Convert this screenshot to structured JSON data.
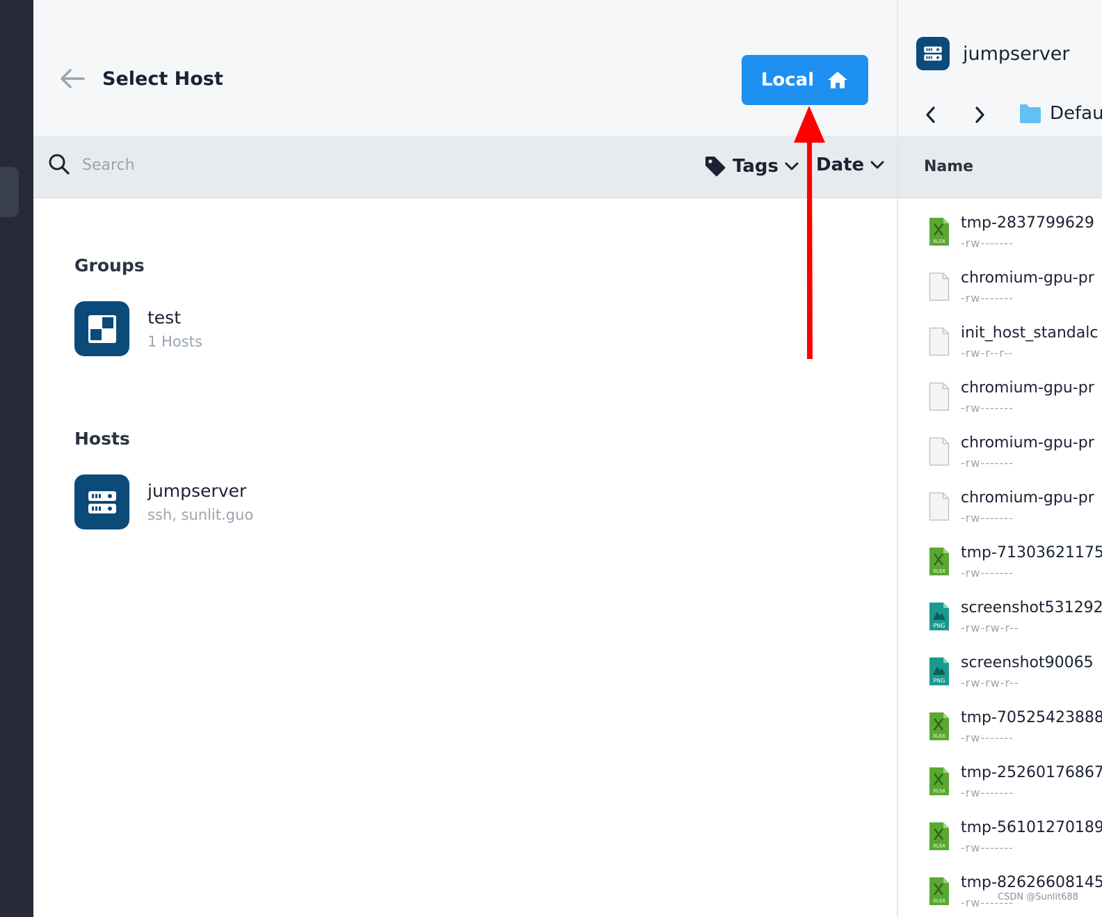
{
  "header": {
    "title": "Select Host",
    "local_button_label": "Local",
    "back_icon": "arrow-left-icon",
    "local_icon": "home-icon"
  },
  "search": {
    "placeholder": "Search",
    "filters": [
      {
        "label": "Tags",
        "icon": "tag-icon"
      },
      {
        "label": "Date"
      }
    ]
  },
  "groups": {
    "title": "Groups",
    "items": [
      {
        "name": "test",
        "subtitle": "1 Hosts",
        "icon": "group-icon"
      }
    ]
  },
  "hosts": {
    "title": "Hosts",
    "items": [
      {
        "name": "jumpserver",
        "subtitle": "ssh, sunlit.guo",
        "icon": "server-icon"
      }
    ]
  },
  "sftp": {
    "host_name": "jumpserver",
    "folder_label": "Defau",
    "column_name": "Name",
    "files": [
      {
        "name": "tmp-2837799629",
        "perm": "-rw-------",
        "type": "xlsx"
      },
      {
        "name": "chromium-gpu-pr",
        "perm": "-rw-------",
        "type": "file"
      },
      {
        "name": "init_host_standalc",
        "perm": "-rw-r--r--",
        "type": "file"
      },
      {
        "name": "chromium-gpu-pr",
        "perm": "-rw-------",
        "type": "file"
      },
      {
        "name": "chromium-gpu-pr",
        "perm": "-rw-------",
        "type": "file"
      },
      {
        "name": "chromium-gpu-pr",
        "perm": "-rw-------",
        "type": "file"
      },
      {
        "name": "tmp-71303621175",
        "perm": "-rw-------",
        "type": "xlsx"
      },
      {
        "name": "screenshot531292",
        "perm": "-rw-rw-r--",
        "type": "png"
      },
      {
        "name": "screenshot90065",
        "perm": "-rw-rw-r--",
        "type": "png"
      },
      {
        "name": "tmp-70525423888",
        "perm": "-rw-------",
        "type": "xlsx"
      },
      {
        "name": "tmp-25260176867",
        "perm": "-rw-------",
        "type": "xlsx"
      },
      {
        "name": "tmp-56101270189",
        "perm": "-rw-------",
        "type": "xlsx"
      },
      {
        "name": "tmp-82626608145",
        "perm": "-rw-------",
        "type": "xlsx"
      }
    ]
  },
  "watermark": "CSDN @Sunlit688",
  "colors": {
    "accent": "#1e90f2",
    "tile": "#0c4a7a",
    "sidebar": "#272b38",
    "annotation_arrow": "#ff0000",
    "xlsx": "#5aa832",
    "png": "#1a9a8e"
  }
}
